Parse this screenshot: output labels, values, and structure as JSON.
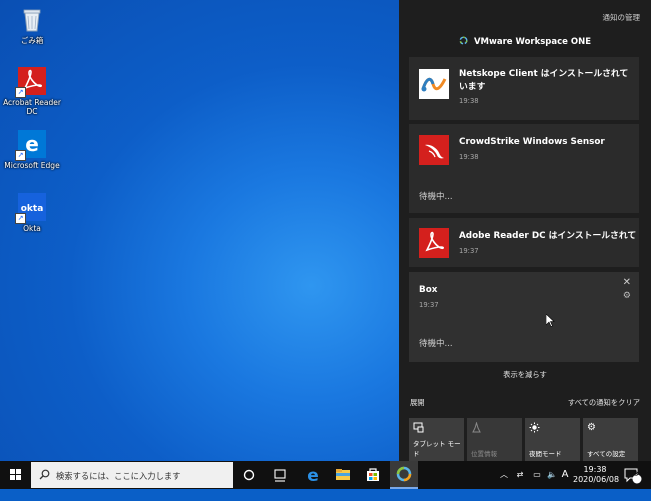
{
  "desktop": {
    "icons": [
      {
        "label": "ごみ箱",
        "icon": "recycle-bin-icon"
      },
      {
        "label": "Acrobat Reader\nDC",
        "icon": "adobe-acrobat-icon"
      },
      {
        "label": "Microsoft Edge",
        "icon": "edge-icon"
      },
      {
        "label": "Okta",
        "icon": "okta-icon",
        "glyph_text": "okta"
      }
    ]
  },
  "action_center": {
    "manage_label": "通知の管理",
    "app_header": "VMware Workspace ONE",
    "notifications": [
      {
        "title": "Netskope Client はインストールされています",
        "time": "19:38",
        "icon": "netskope-icon"
      },
      {
        "title": "CrowdStrike Windows Sensor",
        "time": "19:38",
        "status": "待機中...",
        "icon": "crowdstrike-icon"
      },
      {
        "title": "Adobe Reader DC はインストールされてい",
        "time": "19:37",
        "icon": "adobe-reader-icon"
      },
      {
        "title": "Box",
        "time": "19:37",
        "status": "待機中...",
        "icon": "none"
      }
    ],
    "show_less": "表示を減らす",
    "expand": "展開",
    "clear_all": "すべての通知をクリア",
    "quick_actions": [
      {
        "label": "タブレット モード",
        "icon": "tablet-mode-icon",
        "enabled": true
      },
      {
        "label": "位置情報",
        "icon": "location-icon",
        "enabled": false
      },
      {
        "label": "夜間モード",
        "icon": "night-light-icon",
        "enabled": true
      },
      {
        "label": "すべての設定",
        "icon": "settings-gear-icon",
        "enabled": true
      }
    ]
  },
  "taskbar": {
    "search_placeholder": "検索するには、ここに入力します",
    "ime": "A",
    "clock_time": "19:38",
    "clock_date": "2020/06/08",
    "notification_count": "3"
  },
  "colors": {
    "desktop_blue": "#0a5fc7",
    "action_center_bg": "#1e1e1e",
    "card_bg": "#2b2b2b",
    "adobe_red": "#d4201d",
    "edge_blue": "#0078d7"
  }
}
